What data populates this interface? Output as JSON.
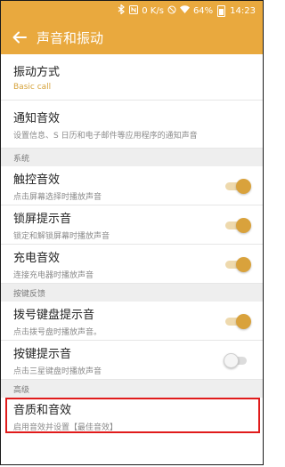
{
  "status_bar": {
    "icons": [
      "bluetooth-icon",
      "nfc-icon",
      "mute-icon",
      "wifi-icon",
      "battery-icon"
    ],
    "speed": "0 K/s",
    "battery": "64%",
    "time": "14:23"
  },
  "app_bar": {
    "title": "声音和振动",
    "back_icon": "arrow-left-icon",
    "color": "#e9a93e"
  },
  "items": {
    "vibration": {
      "title": "振动方式",
      "subtitle": "Basic call"
    },
    "notification": {
      "title": "通知音效",
      "subtitle": "设置信息、S 日历和电子邮件等应用程序的通知声音"
    }
  },
  "sections": {
    "system": "系统",
    "key_feedback": "按键反馈",
    "advanced": "高级"
  },
  "system_items": [
    {
      "title": "触控音效",
      "subtitle": "点击屏幕选择时播放声音",
      "toggle": true
    },
    {
      "title": "锁屏提示音",
      "subtitle": "锁定和解锁屏幕时播放声音",
      "toggle": true
    },
    {
      "title": "充电音效",
      "subtitle": "连接充电器时播放声音",
      "toggle": true
    }
  ],
  "key_items": [
    {
      "title": "拨号键盘提示音",
      "subtitle": "点击拨号盘时播放声音。",
      "toggle": true
    },
    {
      "title": "按键提示音",
      "subtitle": "点击三星键盘时播放声音",
      "toggle": false
    }
  ],
  "advanced_item": {
    "title": "音质和音效",
    "subtitle": "启用音效并设置【最佳音效】"
  },
  "colors": {
    "accent": "#d9a23c",
    "highlight": "#e01b1b"
  }
}
